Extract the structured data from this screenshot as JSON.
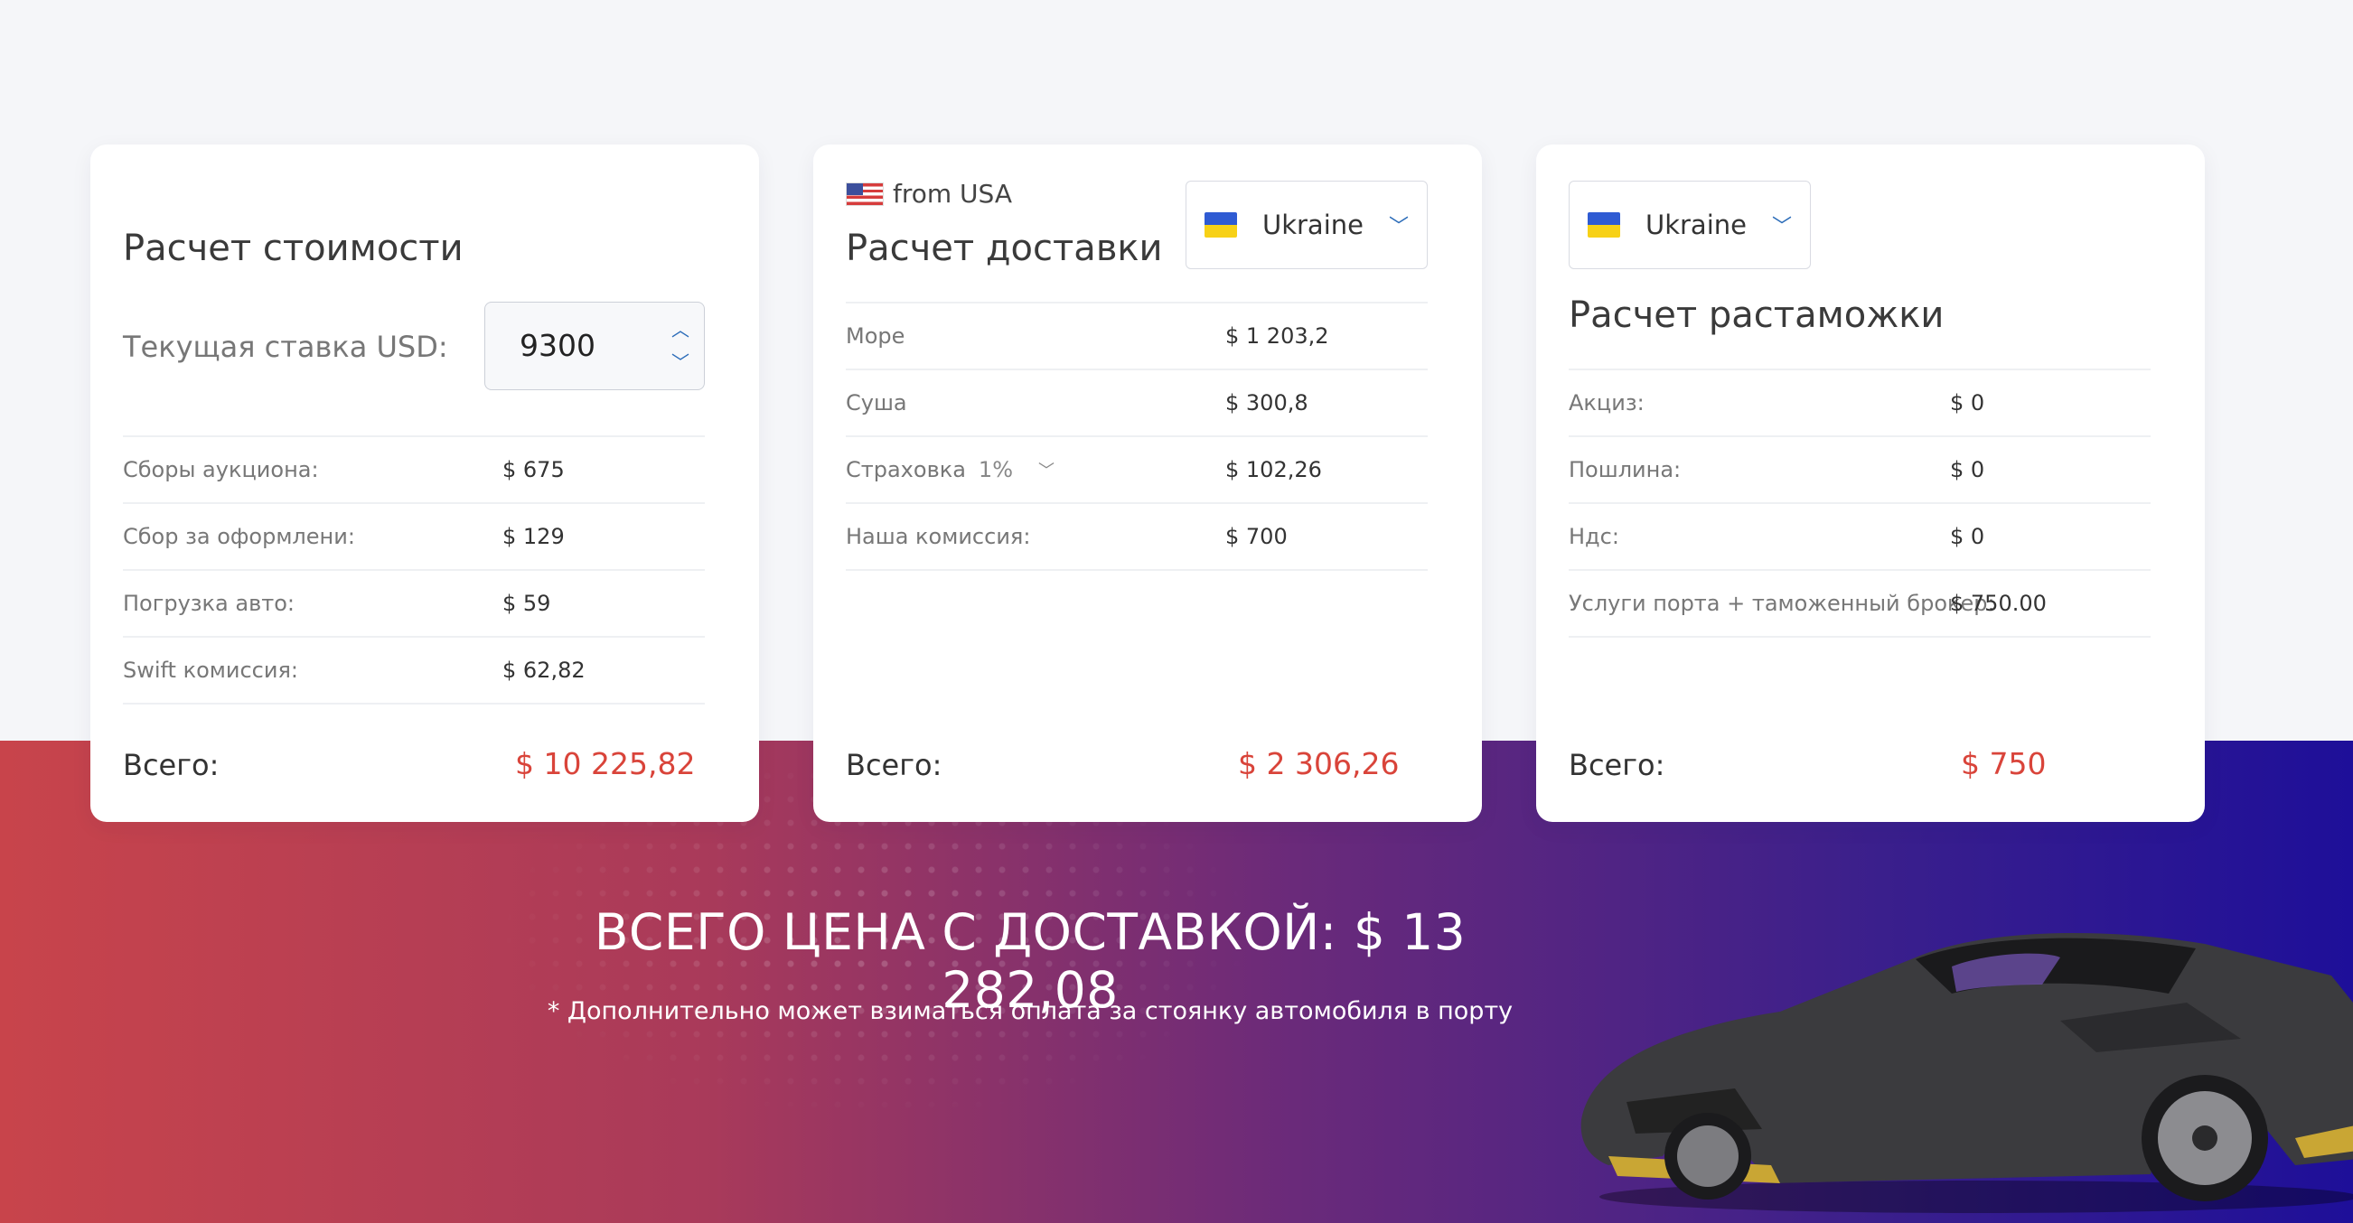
{
  "card_cost": {
    "title": "Расчет стоимости",
    "usd_rate_label": "Текущая ставка USD:",
    "usd_rate_value": "9300",
    "rows": [
      {
        "label": "Сборы аукциона:",
        "value": "$ 675"
      },
      {
        "label": "Сбор за оформлени:",
        "value": "$ 129"
      },
      {
        "label": "Погрузка авто:",
        "value": "$ 59"
      },
      {
        "label": "Swift комиссия:",
        "value": "$ 62,82"
      }
    ],
    "total_label": "Всего:",
    "total_value": "$ 10 225,82"
  },
  "card_delivery": {
    "from_label": "from USA",
    "title": "Расчет доставки",
    "country_select": "Ukraine",
    "rows": [
      {
        "label": "Море",
        "value": "$ 1 203,2"
      },
      {
        "label": "Суша",
        "value": "$ 300,8"
      },
      {
        "label": "Страховка",
        "percent": "1%",
        "value": "$ 102,26"
      },
      {
        "label": "Наша комиссия:",
        "value": "$ 700"
      }
    ],
    "total_label": "Всего:",
    "total_value": "$ 2 306,26"
  },
  "card_customs": {
    "country_select": "Ukraine",
    "title": "Расчет растаможки",
    "rows": [
      {
        "label": "Акциз:",
        "value": "$ 0"
      },
      {
        "label": "Пошлина:",
        "value": "$ 0"
      },
      {
        "label": "Ндс:",
        "value": "$ 0"
      },
      {
        "label": "Услуги порта + таможенный брокер:",
        "value": "$ 750.00"
      }
    ],
    "total_label": "Всего:",
    "total_value": "$ 750"
  },
  "banner": {
    "grand_total": "ВСЕГО ЦЕНА С ДОСТАВКОЙ: $ 13 282,08",
    "note": "* Дополнительно может взиматься оплата за стоянку автомобиля в порту"
  },
  "colors": {
    "accent_red": "#d9443a",
    "accent_blue": "#2a6bb8"
  }
}
